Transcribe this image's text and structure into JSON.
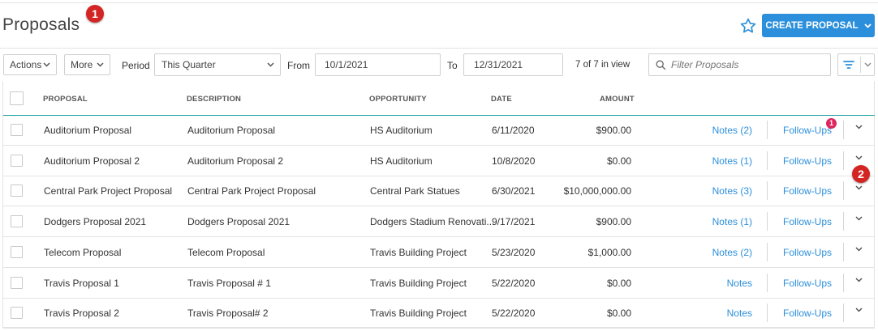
{
  "page": {
    "title": "Proposals"
  },
  "markers": {
    "m1": "1",
    "m2": "2"
  },
  "header": {
    "create_label": "CREATE PROPOSAL"
  },
  "toolbar": {
    "actions_label": "Actions",
    "more_label": "More",
    "period_label": "Period",
    "period_value": "This Quarter",
    "from_label": "From",
    "from_value": "10/1/2021",
    "to_label": "To",
    "to_value": "12/31/2021",
    "count_text": "7 of 7 in view",
    "filter_placeholder": "Filter Proposals"
  },
  "columns": {
    "proposal": "PROPOSAL",
    "description": "DESCRIPTION",
    "opportunity": "OPPORTUNITY",
    "date": "DATE",
    "amount": "AMOUNT"
  },
  "rows": [
    {
      "proposal": "Auditorium Proposal",
      "description": "Auditorium Proposal",
      "opportunity": "HS Auditorium",
      "date": "6/11/2020",
      "amount": "$900.00",
      "notes": "Notes (2)",
      "followups": "Follow-Ups",
      "followup_badge": "1"
    },
    {
      "proposal": "Auditorium Proposal 2",
      "description": "Auditorium Proposal 2",
      "opportunity": "HS Auditorium",
      "date": "10/8/2020",
      "amount": "$0.00",
      "notes": "Notes (1)",
      "followups": "Follow-Ups"
    },
    {
      "proposal": "Central Park Project Proposal",
      "description": "Central Park Project Proposal",
      "opportunity": "Central Park Statues",
      "date": "6/30/2021",
      "amount": "$10,000,000.00",
      "notes": "Notes (3)",
      "followups": "Follow-Ups"
    },
    {
      "proposal": "Dodgers Proposal 2021",
      "description": "Dodgers Proposal 2021",
      "opportunity": "Dodgers Stadium Renovati...",
      "date": "9/17/2021",
      "amount": "$900.00",
      "notes": "Notes (1)",
      "followups": "Follow-Ups"
    },
    {
      "proposal": "Telecom Proposal",
      "description": "Telecom Proposal",
      "opportunity": "Travis Building Project",
      "date": "5/23/2020",
      "amount": "$1,000.00",
      "notes": "Notes (2)",
      "followups": "Follow-Ups"
    },
    {
      "proposal": "Travis Proposal 1",
      "description": "Travis Proposal # 1",
      "opportunity": "Travis Building Project",
      "date": "5/22/2020",
      "amount": "$0.00",
      "notes": "Notes",
      "followups": "Follow-Ups"
    },
    {
      "proposal": "Travis Proposal 2",
      "description": "Travis Proposal# 2",
      "opportunity": "Travis Building Project",
      "date": "5/22/2020",
      "amount": "$0.00",
      "notes": "Notes",
      "followups": "Follow-Ups"
    }
  ],
  "colors": {
    "accent": "#2b8fdb",
    "marker": "#d42525",
    "badge": "#e0245e",
    "header_rule": "#1a9e9e"
  },
  "icons": {
    "star": "star-outline-icon",
    "search": "search-icon",
    "filter": "filter-icon",
    "chevron": "chevron-down-icon"
  }
}
